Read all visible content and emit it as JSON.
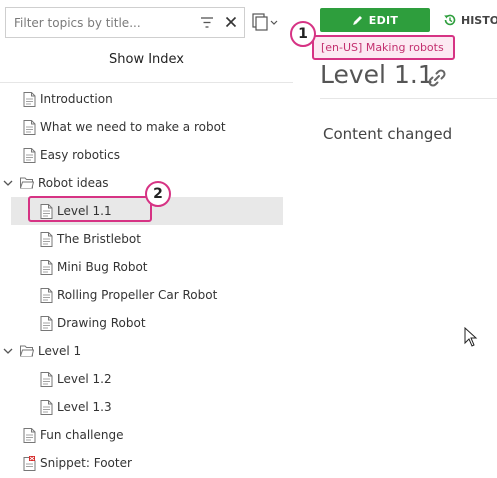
{
  "filter": {
    "placeholder": "Filter topics by title..."
  },
  "show_index_label": "Show Index",
  "tree": [
    {
      "label": "Introduction",
      "kind": "doc"
    },
    {
      "label": "What we need to make a robot",
      "kind": "doc"
    },
    {
      "label": "Easy robotics",
      "kind": "doc"
    },
    {
      "label": "Robot ideas",
      "kind": "folder",
      "expanded": true
    },
    {
      "label": "Level 1.1",
      "kind": "doc",
      "selected": true
    },
    {
      "label": "The Bristlebot",
      "kind": "doc"
    },
    {
      "label": "Mini Bug Robot",
      "kind": "doc"
    },
    {
      "label": "Rolling Propeller Car Robot",
      "kind": "doc"
    },
    {
      "label": "Drawing Robot",
      "kind": "doc"
    },
    {
      "label": "Level 1",
      "kind": "folder",
      "expanded": true
    },
    {
      "label": "Level 1.2",
      "kind": "doc"
    },
    {
      "label": "Level 1.3",
      "kind": "doc"
    },
    {
      "label": "Fun challenge",
      "kind": "doc"
    },
    {
      "label": "Snippet: Footer",
      "kind": "snippet"
    }
  ],
  "toolbar": {
    "edit_label": "EDIT",
    "history_label": "HISTO"
  },
  "breadcrumb": "[en-US] Making robots",
  "page_title": "Level 1.1",
  "content": "Content changed",
  "badges": {
    "one": "1",
    "two": "2"
  },
  "colors": {
    "edit_green": "#2e9e3d",
    "highlight_pink": "#d63384"
  }
}
